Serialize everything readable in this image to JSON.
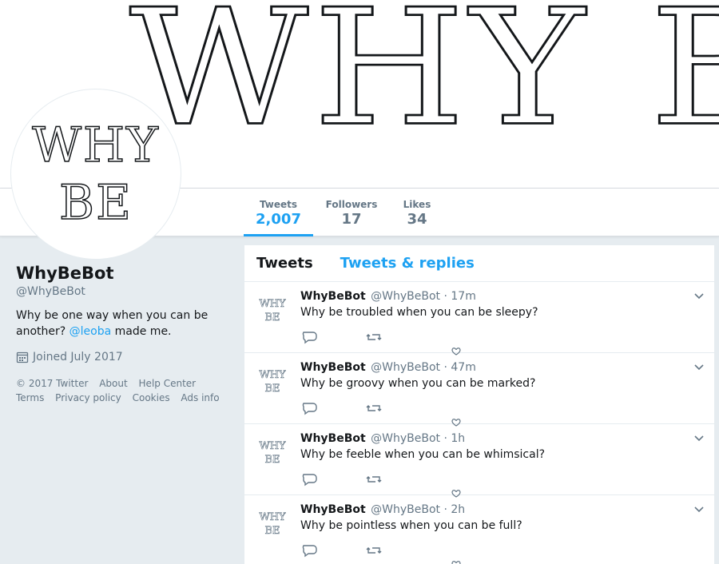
{
  "banner": {
    "text": "WHY BE?"
  },
  "avatar": {
    "line1": "WHY",
    "line2": "BE"
  },
  "stats": [
    {
      "label": "Tweets",
      "value": "2,007"
    },
    {
      "label": "Followers",
      "value": "17"
    },
    {
      "label": "Likes",
      "value": "34"
    }
  ],
  "profile": {
    "name": "WhyBeBot",
    "handle": "@WhyBeBot",
    "bio_before": "Why be one way when you can be another?",
    "bio_mention": "@leoba",
    "bio_after": "made me.",
    "joined": "Joined July 2017"
  },
  "footer": {
    "copyright": "© 2017 Twitter",
    "about": "About",
    "help": "Help Center",
    "terms": "Terms",
    "privacy": "Privacy policy",
    "cookies": "Cookies",
    "ads": "Ads info"
  },
  "tabs": [
    {
      "label": "Tweets"
    },
    {
      "label": "Tweets & replies"
    }
  ],
  "tweets": [
    {
      "author": "WhyBeBot",
      "handle": "@WhyBeBot",
      "time": "· 17m",
      "text": "Why be troubled when you can be sleepy?"
    },
    {
      "author": "WhyBeBot",
      "handle": "@WhyBeBot",
      "time": "· 47m",
      "text": "Why be groovy when you can be marked?"
    },
    {
      "author": "WhyBeBot",
      "handle": "@WhyBeBot",
      "time": "· 1h",
      "text": "Why be feeble when you can be whimsical?"
    },
    {
      "author": "WhyBeBot",
      "handle": "@WhyBeBot",
      "time": "· 2h",
      "text": "Why be pointless when you can be full?"
    }
  ],
  "colors": {
    "accent": "#1da1f2",
    "muted": "#657786",
    "background": "#e6ecf0"
  },
  "icons": {
    "calendar": "calendar-icon",
    "reply": "reply-icon",
    "retweet": "retweet-icon",
    "like": "heart-icon",
    "caret": "chevron-down-icon"
  }
}
